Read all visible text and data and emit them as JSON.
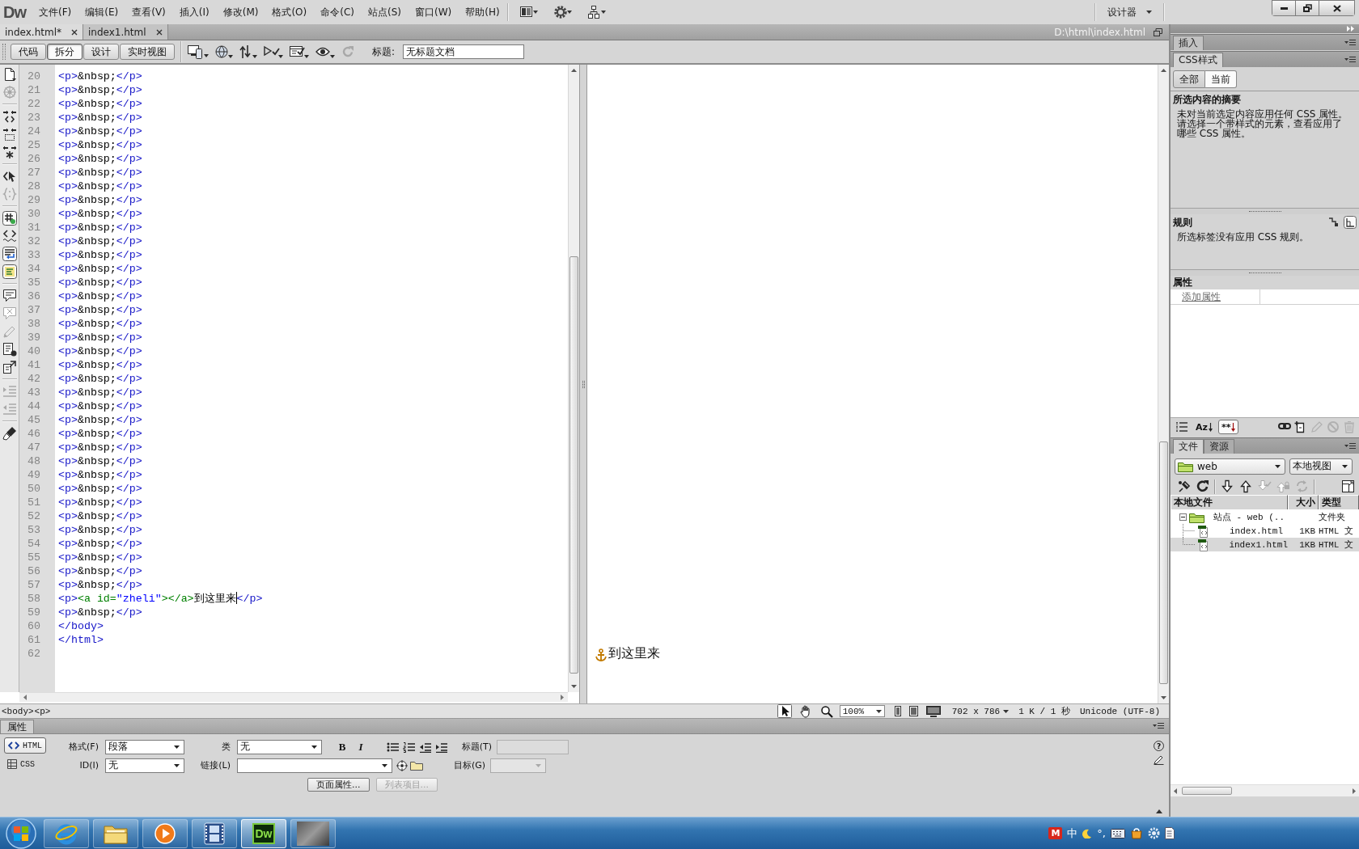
{
  "menubar": {
    "logo": "Dw",
    "menus": [
      "文件(F)",
      "编辑(E)",
      "查看(V)",
      "插入(I)",
      "修改(M)",
      "格式(O)",
      "命令(C)",
      "站点(S)",
      "窗口(W)",
      "帮助(H)"
    ],
    "workspace": "设计器"
  },
  "document_tabs": [
    {
      "label": "index.html*",
      "selected": true
    },
    {
      "label": "index1.html",
      "selected": false
    }
  ],
  "file_path": "D:\\html\\index.html",
  "document_toolbar": {
    "views": [
      {
        "label": "代码",
        "selected": false
      },
      {
        "label": "拆分",
        "selected": true
      },
      {
        "label": "设计",
        "selected": false
      },
      {
        "label": "实时视图",
        "selected": false
      }
    ],
    "tools": [
      {
        "kind": "multiscreen",
        "disabled": false
      },
      {
        "kind": "preview",
        "disabled": false
      },
      {
        "kind": "filemanage",
        "disabled": false
      },
      {
        "kind": "validate",
        "disabled": false
      },
      {
        "kind": "browsercheck",
        "disabled": false
      },
      {
        "kind": "visualaids",
        "disabled": false
      },
      {
        "kind": "refresh",
        "disabled": true
      }
    ],
    "title_label": "标题:",
    "title_value": "无标题文档"
  },
  "coding_toolbar": [
    {
      "kind": "document",
      "on": false,
      "disabled": false
    },
    {
      "kind": "navigator",
      "on": false,
      "disabled": true
    },
    {
      "kind": "collapse",
      "on": false,
      "disabled": false
    },
    {
      "kind": "collapsesel",
      "on": false,
      "disabled": false
    },
    {
      "kind": "expand",
      "on": false,
      "disabled": false
    },
    {
      "kind": "parent",
      "on": false,
      "disabled": false
    },
    {
      "kind": "balance",
      "on": false,
      "disabled": true
    },
    {
      "kind": "numbers",
      "on": true,
      "disabled": false
    },
    {
      "kind": "invalid",
      "on": false,
      "disabled": false
    },
    {
      "kind": "wrap",
      "on": true,
      "disabled": false
    },
    {
      "kind": "syntax",
      "on": true,
      "disabled": false
    },
    {
      "kind": "comment",
      "on": false,
      "disabled": false
    },
    {
      "kind": "uncomment",
      "on": false,
      "disabled": true
    },
    {
      "kind": "wraptag",
      "on": false,
      "disabled": true
    },
    {
      "kind": "snippets",
      "on": false,
      "disabled": false
    },
    {
      "kind": "movecss",
      "on": false,
      "disabled": false
    },
    {
      "kind": "indent",
      "on": false,
      "disabled": true
    },
    {
      "kind": "outdent",
      "on": false,
      "disabled": true
    },
    {
      "kind": "format",
      "on": false,
      "disabled": false
    }
  ],
  "code_view": {
    "lines": [
      {
        "number": "20",
        "tokens": [
          {
            "kind": "tag",
            "text": "<p>"
          },
          {
            "kind": "text",
            "text": "&nbsp;"
          },
          {
            "kind": "tag",
            "text": "</p>"
          }
        ]
      },
      {
        "number": "21",
        "tokens": [
          {
            "kind": "tag",
            "text": "<p>"
          },
          {
            "kind": "text",
            "text": "&nbsp;"
          },
          {
            "kind": "tag",
            "text": "</p>"
          }
        ]
      },
      {
        "number": "22",
        "tokens": [
          {
            "kind": "tag",
            "text": "<p>"
          },
          {
            "kind": "text",
            "text": "&nbsp;"
          },
          {
            "kind": "tag",
            "text": "</p>"
          }
        ]
      },
      {
        "number": "23",
        "tokens": [
          {
            "kind": "tag",
            "text": "<p>"
          },
          {
            "kind": "text",
            "text": "&nbsp;"
          },
          {
            "kind": "tag",
            "text": "</p>"
          }
        ]
      },
      {
        "number": "24",
        "tokens": [
          {
            "kind": "tag",
            "text": "<p>"
          },
          {
            "kind": "text",
            "text": "&nbsp;"
          },
          {
            "kind": "tag",
            "text": "</p>"
          }
        ]
      },
      {
        "number": "25",
        "tokens": [
          {
            "kind": "tag",
            "text": "<p>"
          },
          {
            "kind": "text",
            "text": "&nbsp;"
          },
          {
            "kind": "tag",
            "text": "</p>"
          }
        ]
      },
      {
        "number": "26",
        "tokens": [
          {
            "kind": "tag",
            "text": "<p>"
          },
          {
            "kind": "text",
            "text": "&nbsp;"
          },
          {
            "kind": "tag",
            "text": "</p>"
          }
        ]
      },
      {
        "number": "27",
        "tokens": [
          {
            "kind": "tag",
            "text": "<p>"
          },
          {
            "kind": "text",
            "text": "&nbsp;"
          },
          {
            "kind": "tag",
            "text": "</p>"
          }
        ]
      },
      {
        "number": "28",
        "tokens": [
          {
            "kind": "tag",
            "text": "<p>"
          },
          {
            "kind": "text",
            "text": "&nbsp;"
          },
          {
            "kind": "tag",
            "text": "</p>"
          }
        ]
      },
      {
        "number": "29",
        "tokens": [
          {
            "kind": "tag",
            "text": "<p>"
          },
          {
            "kind": "text",
            "text": "&nbsp;"
          },
          {
            "kind": "tag",
            "text": "</p>"
          }
        ]
      },
      {
        "number": "30",
        "tokens": [
          {
            "kind": "tag",
            "text": "<p>"
          },
          {
            "kind": "text",
            "text": "&nbsp;"
          },
          {
            "kind": "tag",
            "text": "</p>"
          }
        ]
      },
      {
        "number": "31",
        "tokens": [
          {
            "kind": "tag",
            "text": "<p>"
          },
          {
            "kind": "text",
            "text": "&nbsp;"
          },
          {
            "kind": "tag",
            "text": "</p>"
          }
        ]
      },
      {
        "number": "32",
        "tokens": [
          {
            "kind": "tag",
            "text": "<p>"
          },
          {
            "kind": "text",
            "text": "&nbsp;"
          },
          {
            "kind": "tag",
            "text": "</p>"
          }
        ]
      },
      {
        "number": "33",
        "tokens": [
          {
            "kind": "tag",
            "text": "<p>"
          },
          {
            "kind": "text",
            "text": "&nbsp;"
          },
          {
            "kind": "tag",
            "text": "</p>"
          }
        ]
      },
      {
        "number": "34",
        "tokens": [
          {
            "kind": "tag",
            "text": "<p>"
          },
          {
            "kind": "text",
            "text": "&nbsp;"
          },
          {
            "kind": "tag",
            "text": "</p>"
          }
        ]
      },
      {
        "number": "35",
        "tokens": [
          {
            "kind": "tag",
            "text": "<p>"
          },
          {
            "kind": "text",
            "text": "&nbsp;"
          },
          {
            "kind": "tag",
            "text": "</p>"
          }
        ]
      },
      {
        "number": "36",
        "tokens": [
          {
            "kind": "tag",
            "text": "<p>"
          },
          {
            "kind": "text",
            "text": "&nbsp;"
          },
          {
            "kind": "tag",
            "text": "</p>"
          }
        ]
      },
      {
        "number": "37",
        "tokens": [
          {
            "kind": "tag",
            "text": "<p>"
          },
          {
            "kind": "text",
            "text": "&nbsp;"
          },
          {
            "kind": "tag",
            "text": "</p>"
          }
        ]
      },
      {
        "number": "38",
        "tokens": [
          {
            "kind": "tag",
            "text": "<p>"
          },
          {
            "kind": "text",
            "text": "&nbsp;"
          },
          {
            "kind": "tag",
            "text": "</p>"
          }
        ]
      },
      {
        "number": "39",
        "tokens": [
          {
            "kind": "tag",
            "text": "<p>"
          },
          {
            "kind": "text",
            "text": "&nbsp;"
          },
          {
            "kind": "tag",
            "text": "</p>"
          }
        ]
      },
      {
        "number": "40",
        "tokens": [
          {
            "kind": "tag",
            "text": "<p>"
          },
          {
            "kind": "text",
            "text": "&nbsp;"
          },
          {
            "kind": "tag",
            "text": "</p>"
          }
        ]
      },
      {
        "number": "41",
        "tokens": [
          {
            "kind": "tag",
            "text": "<p>"
          },
          {
            "kind": "text",
            "text": "&nbsp;"
          },
          {
            "kind": "tag",
            "text": "</p>"
          }
        ]
      },
      {
        "number": "42",
        "tokens": [
          {
            "kind": "tag",
            "text": "<p>"
          },
          {
            "kind": "text",
            "text": "&nbsp;"
          },
          {
            "kind": "tag",
            "text": "</p>"
          }
        ]
      },
      {
        "number": "43",
        "tokens": [
          {
            "kind": "tag",
            "text": "<p>"
          },
          {
            "kind": "text",
            "text": "&nbsp;"
          },
          {
            "kind": "tag",
            "text": "</p>"
          }
        ]
      },
      {
        "number": "44",
        "tokens": [
          {
            "kind": "tag",
            "text": "<p>"
          },
          {
            "kind": "text",
            "text": "&nbsp;"
          },
          {
            "kind": "tag",
            "text": "</p>"
          }
        ]
      },
      {
        "number": "45",
        "tokens": [
          {
            "kind": "tag",
            "text": "<p>"
          },
          {
            "kind": "text",
            "text": "&nbsp;"
          },
          {
            "kind": "tag",
            "text": "</p>"
          }
        ]
      },
      {
        "number": "46",
        "tokens": [
          {
            "kind": "tag",
            "text": "<p>"
          },
          {
            "kind": "text",
            "text": "&nbsp;"
          },
          {
            "kind": "tag",
            "text": "</p>"
          }
        ]
      },
      {
        "number": "47",
        "tokens": [
          {
            "kind": "tag",
            "text": "<p>"
          },
          {
            "kind": "text",
            "text": "&nbsp;"
          },
          {
            "kind": "tag",
            "text": "</p>"
          }
        ]
      },
      {
        "number": "48",
        "tokens": [
          {
            "kind": "tag",
            "text": "<p>"
          },
          {
            "kind": "text",
            "text": "&nbsp;"
          },
          {
            "kind": "tag",
            "text": "</p>"
          }
        ]
      },
      {
        "number": "49",
        "tokens": [
          {
            "kind": "tag",
            "text": "<p>"
          },
          {
            "kind": "text",
            "text": "&nbsp;"
          },
          {
            "kind": "tag",
            "text": "</p>"
          }
        ]
      },
      {
        "number": "50",
        "tokens": [
          {
            "kind": "tag",
            "text": "<p>"
          },
          {
            "kind": "text",
            "text": "&nbsp;"
          },
          {
            "kind": "tag",
            "text": "</p>"
          }
        ]
      },
      {
        "number": "51",
        "tokens": [
          {
            "kind": "tag",
            "text": "<p>"
          },
          {
            "kind": "text",
            "text": "&nbsp;"
          },
          {
            "kind": "tag",
            "text": "</p>"
          }
        ]
      },
      {
        "number": "52",
        "tokens": [
          {
            "kind": "tag",
            "text": "<p>"
          },
          {
            "kind": "text",
            "text": "&nbsp;"
          },
          {
            "kind": "tag",
            "text": "</p>"
          }
        ]
      },
      {
        "number": "53",
        "tokens": [
          {
            "kind": "tag",
            "text": "<p>"
          },
          {
            "kind": "text",
            "text": "&nbsp;"
          },
          {
            "kind": "tag",
            "text": "</p>"
          }
        ]
      },
      {
        "number": "54",
        "tokens": [
          {
            "kind": "tag",
            "text": "<p>"
          },
          {
            "kind": "text",
            "text": "&nbsp;"
          },
          {
            "kind": "tag",
            "text": "</p>"
          }
        ]
      },
      {
        "number": "55",
        "tokens": [
          {
            "kind": "tag",
            "text": "<p>"
          },
          {
            "kind": "text",
            "text": "&nbsp;"
          },
          {
            "kind": "tag",
            "text": "</p>"
          }
        ]
      },
      {
        "number": "56",
        "tokens": [
          {
            "kind": "tag",
            "text": "<p>"
          },
          {
            "kind": "text",
            "text": "&nbsp;"
          },
          {
            "kind": "tag",
            "text": "</p>"
          }
        ]
      },
      {
        "number": "57",
        "tokens": [
          {
            "kind": "tag",
            "text": "<p>"
          },
          {
            "kind": "text",
            "text": "&nbsp;"
          },
          {
            "kind": "tag",
            "text": "</p>"
          }
        ]
      },
      {
        "number": "58",
        "tokens": [
          {
            "kind": "tag",
            "text": "<p>"
          },
          {
            "kind": "anchor",
            "text": "<a id="
          },
          {
            "kind": "value",
            "text": "\"zheli\""
          },
          {
            "kind": "anchor",
            "text": "></a>"
          },
          {
            "kind": "text",
            "text": "到这里来"
          },
          {
            "kind": "cursor"
          },
          {
            "kind": "tag",
            "text": "</p>"
          }
        ]
      },
      {
        "number": "59",
        "tokens": [
          {
            "kind": "tag",
            "text": "<p>"
          },
          {
            "kind": "text",
            "text": "&nbsp;"
          },
          {
            "kind": "tag",
            "text": "</p>"
          }
        ]
      },
      {
        "number": "60",
        "tokens": [
          {
            "kind": "tag",
            "text": "</body>"
          }
        ]
      },
      {
        "number": "61",
        "tokens": [
          {
            "kind": "tag",
            "text": "</html>"
          }
        ]
      },
      {
        "number": "62"
      }
    ]
  },
  "design_view": {
    "text": "到这里来"
  },
  "status_bar": {
    "tags": [
      "<body>",
      "<p>"
    ],
    "tools": [
      {
        "kind": "pointer",
        "selected": true
      },
      {
        "kind": "hand",
        "selected": false
      },
      {
        "kind": "zoom",
        "selected": false
      }
    ],
    "zoom": "100%",
    "window_size": "702 x 786",
    "download": "1 K / 1 秒",
    "encoding": "Unicode (UTF-8)"
  },
  "properties": {
    "title": "属性",
    "modes": [
      {
        "label": "HTML",
        "selected": true
      },
      {
        "label": "CSS",
        "selected": false
      }
    ],
    "format": {
      "label": "格式(F)",
      "value": "段落"
    },
    "id": {
      "label": "ID(I)",
      "value": "无"
    },
    "class": {
      "label": "类",
      "value": "无"
    },
    "bold": "B",
    "italic": "I",
    "heading": {
      "label": "标题(T)",
      "disabled": true
    },
    "link": {
      "label": "链接(L)"
    },
    "target": {
      "label": "目标(G)",
      "disabled": true
    },
    "buttons": [
      {
        "label": "页面属性...",
        "disabled": false
      },
      {
        "label": "列表项目...",
        "disabled": true
      }
    ],
    "help": "?"
  },
  "insert_panel": {
    "tab": "插入"
  },
  "css_panel": {
    "tab": "CSS样式",
    "modes": [
      {
        "label": "全部",
        "selected": false
      },
      {
        "label": "当前",
        "selected": true
      }
    ],
    "summary_title": "所选内容的摘要",
    "summary_text": "未对当前选定内容应用任何 CSS 属性。请选择一个带样式的元素，查看应用了哪些 CSS 属性。",
    "rules_title": "规则",
    "rule_views": [
      {
        "kind": "cascade",
        "selected": false
      },
      {
        "kind": "about",
        "selected": true
      }
    ],
    "rules_text": "所选标签没有应用 CSS 规则。",
    "properties_title": "属性",
    "add_property": "添加属性",
    "view_modes": [
      {
        "kind": "category",
        "selected": false
      },
      {
        "kind": "alphabetical",
        "label": "Az",
        "selected": false
      },
      {
        "kind": "set",
        "label": "**",
        "selected": true
      }
    ],
    "rule_tools": [
      {
        "kind": "attach",
        "disabled": false
      },
      {
        "kind": "newrule",
        "disabled": false
      },
      {
        "kind": "edit",
        "disabled": true
      },
      {
        "kind": "toggle",
        "disabled": true
      },
      {
        "kind": "delete",
        "disabled": true
      }
    ]
  },
  "files_panel": {
    "tabs": [
      {
        "label": "文件",
        "selected": true
      },
      {
        "label": "资源",
        "selected": false
      }
    ],
    "site": "web",
    "view": "本地视图",
    "tools": [
      {
        "kind": "connect",
        "disabled": false
      },
      {
        "kind": "refresh",
        "disabled": false
      },
      {
        "kind": "get",
        "disabled": false
      },
      {
        "kind": "put",
        "disabled": false
      },
      {
        "kind": "checkout",
        "disabled": true
      },
      {
        "kind": "checkin",
        "disabled": true
      },
      {
        "kind": "sync",
        "disabled": true
      },
      {
        "kind": "expand",
        "disabled": false
      }
    ],
    "columns": [
      "本地文件",
      "大小",
      "类型"
    ],
    "tree": [
      {
        "name": "站点 - web (..",
        "type": "文件夹",
        "expanded": true,
        "selected": false,
        "children": [
          {
            "name": "index.html",
            "size": "1KB",
            "type": "HTML 文",
            "selected": false
          },
          {
            "name": "index1.html",
            "size": "1KB",
            "type": "HTML 文",
            "selected": true
          }
        ]
      }
    ]
  },
  "taskbar": {
    "apps": [
      {
        "kind": "browser",
        "active": false
      },
      {
        "kind": "folder",
        "active": false
      },
      {
        "kind": "media",
        "active": false
      },
      {
        "kind": "film",
        "active": false
      },
      {
        "kind": "logo",
        "label": "Dw",
        "active": true
      },
      {
        "kind": "photo",
        "active": false
      }
    ],
    "tray": [
      {
        "kind": "badge",
        "text": "M"
      },
      {
        "kind": "text",
        "text": "中"
      },
      {
        "kind": "moon"
      },
      {
        "kind": "text",
        "text": "°,"
      },
      {
        "kind": "keyboard"
      },
      {
        "kind": "bag"
      },
      {
        "kind": "gear"
      },
      {
        "kind": "page"
      }
    ]
  }
}
